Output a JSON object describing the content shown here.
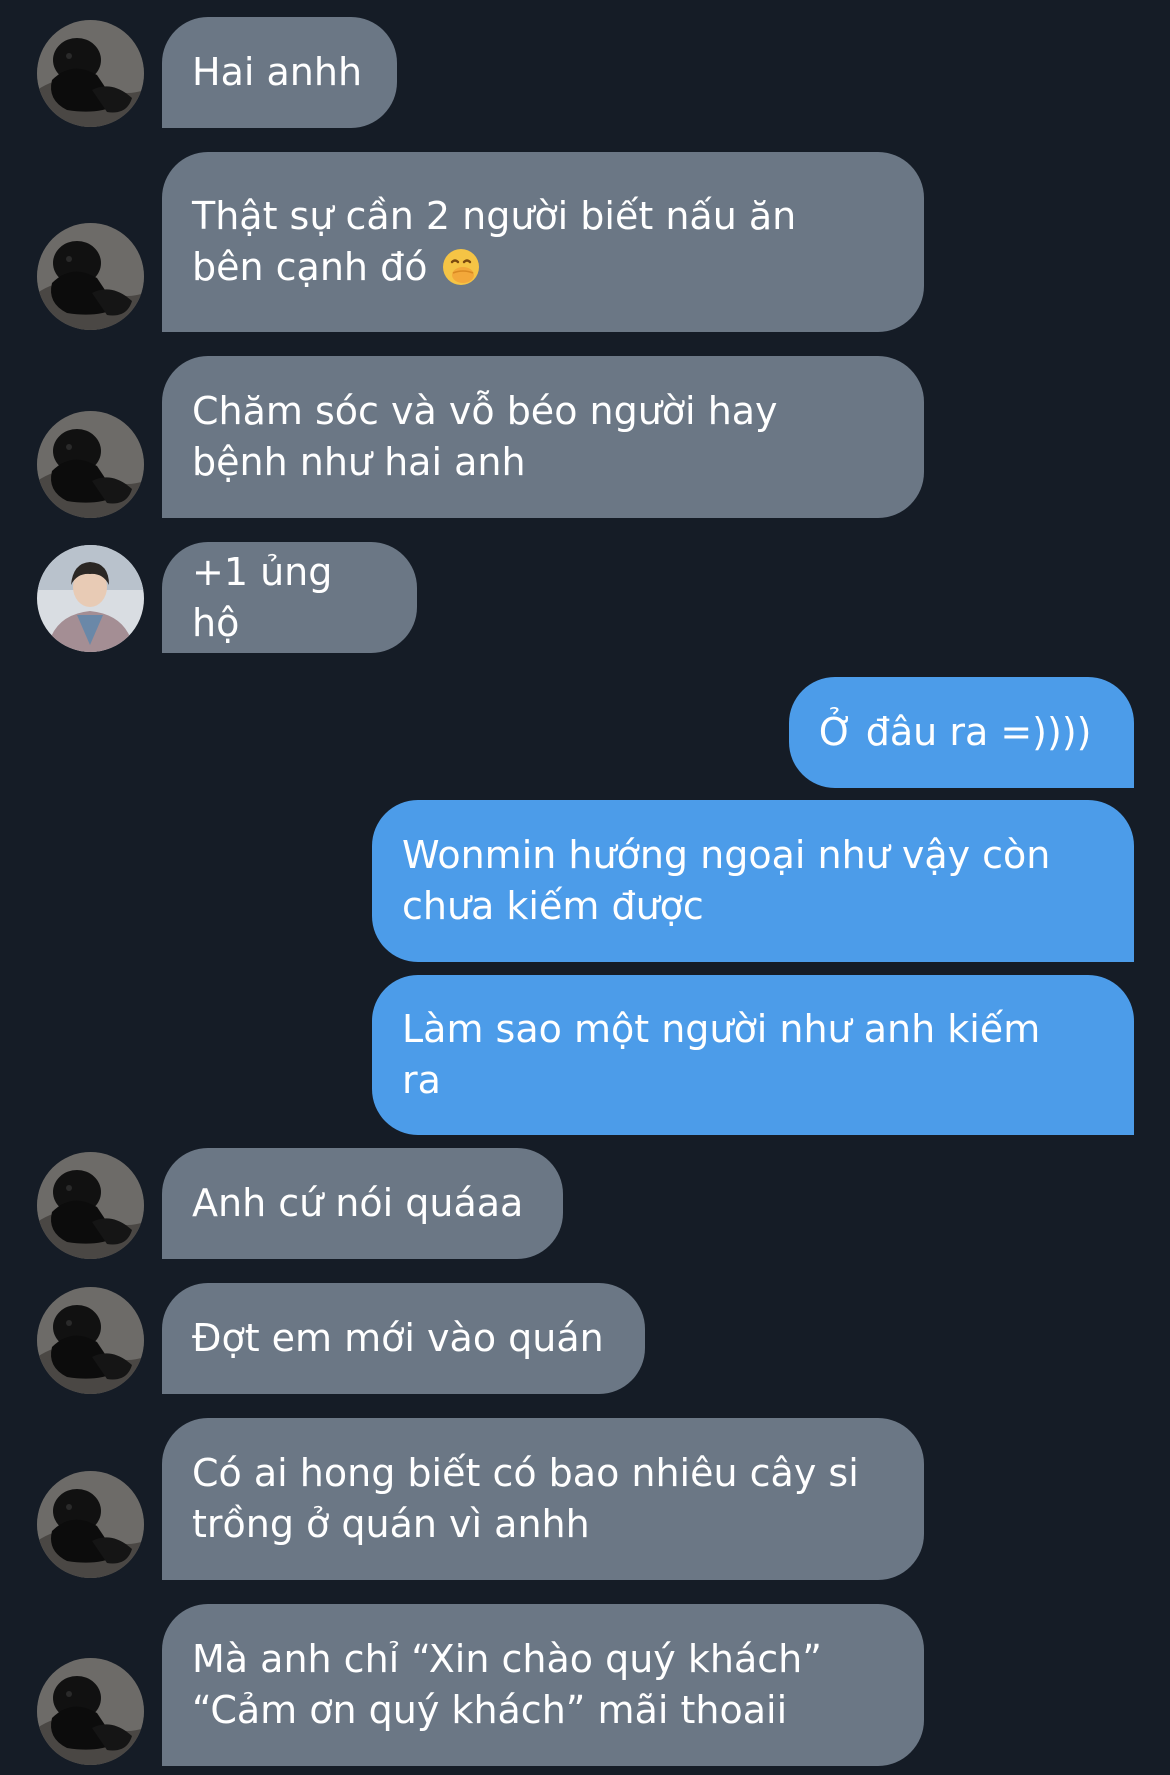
{
  "colors": {
    "background": "#151c26",
    "incoming_bubble": "#6b7785",
    "outgoing_bubble": "#4c9ce9",
    "text": "#ffffff"
  },
  "messages": [
    {
      "direction": "incoming",
      "avatar": "dark-avatar-icon",
      "text": "Hai anhh"
    },
    {
      "direction": "incoming",
      "avatar": "dark-avatar-icon",
      "text": "Thật sự cần 2 người biết nấu ăn\nbên cạnh đó",
      "emoji": "face-with-hand-over-mouth-emoji"
    },
    {
      "direction": "incoming",
      "avatar": "dark-avatar-icon",
      "text": "Chăm sóc và vỗ béo người hay\nbệnh như hai anh"
    },
    {
      "direction": "incoming",
      "avatar": "photo-avatar-icon",
      "text": "+1 ủng hộ"
    },
    {
      "direction": "outgoing",
      "text": "Ở đâu ra =))))"
    },
    {
      "direction": "outgoing",
      "text": "Wonmin hướng ngoại như vậy còn\nchưa kiếm được"
    },
    {
      "direction": "outgoing",
      "text": "Làm sao một người như anh kiếm\nra"
    },
    {
      "direction": "incoming",
      "avatar": "dark-avatar-icon",
      "text": "Anh cứ nói quáaa"
    },
    {
      "direction": "incoming",
      "avatar": "dark-avatar-icon",
      "text": "Đợt em mới vào quán"
    },
    {
      "direction": "incoming",
      "avatar": "dark-avatar-icon",
      "text": "Có ai hong biết có bao nhiêu cây si\ntrồng ở quán vì anhh"
    },
    {
      "direction": "incoming",
      "avatar": "dark-avatar-icon",
      "text": "Mà anh chỉ “Xin chào quý khách”\n“Cảm ơn quý khách” mãi thoaii"
    }
  ]
}
